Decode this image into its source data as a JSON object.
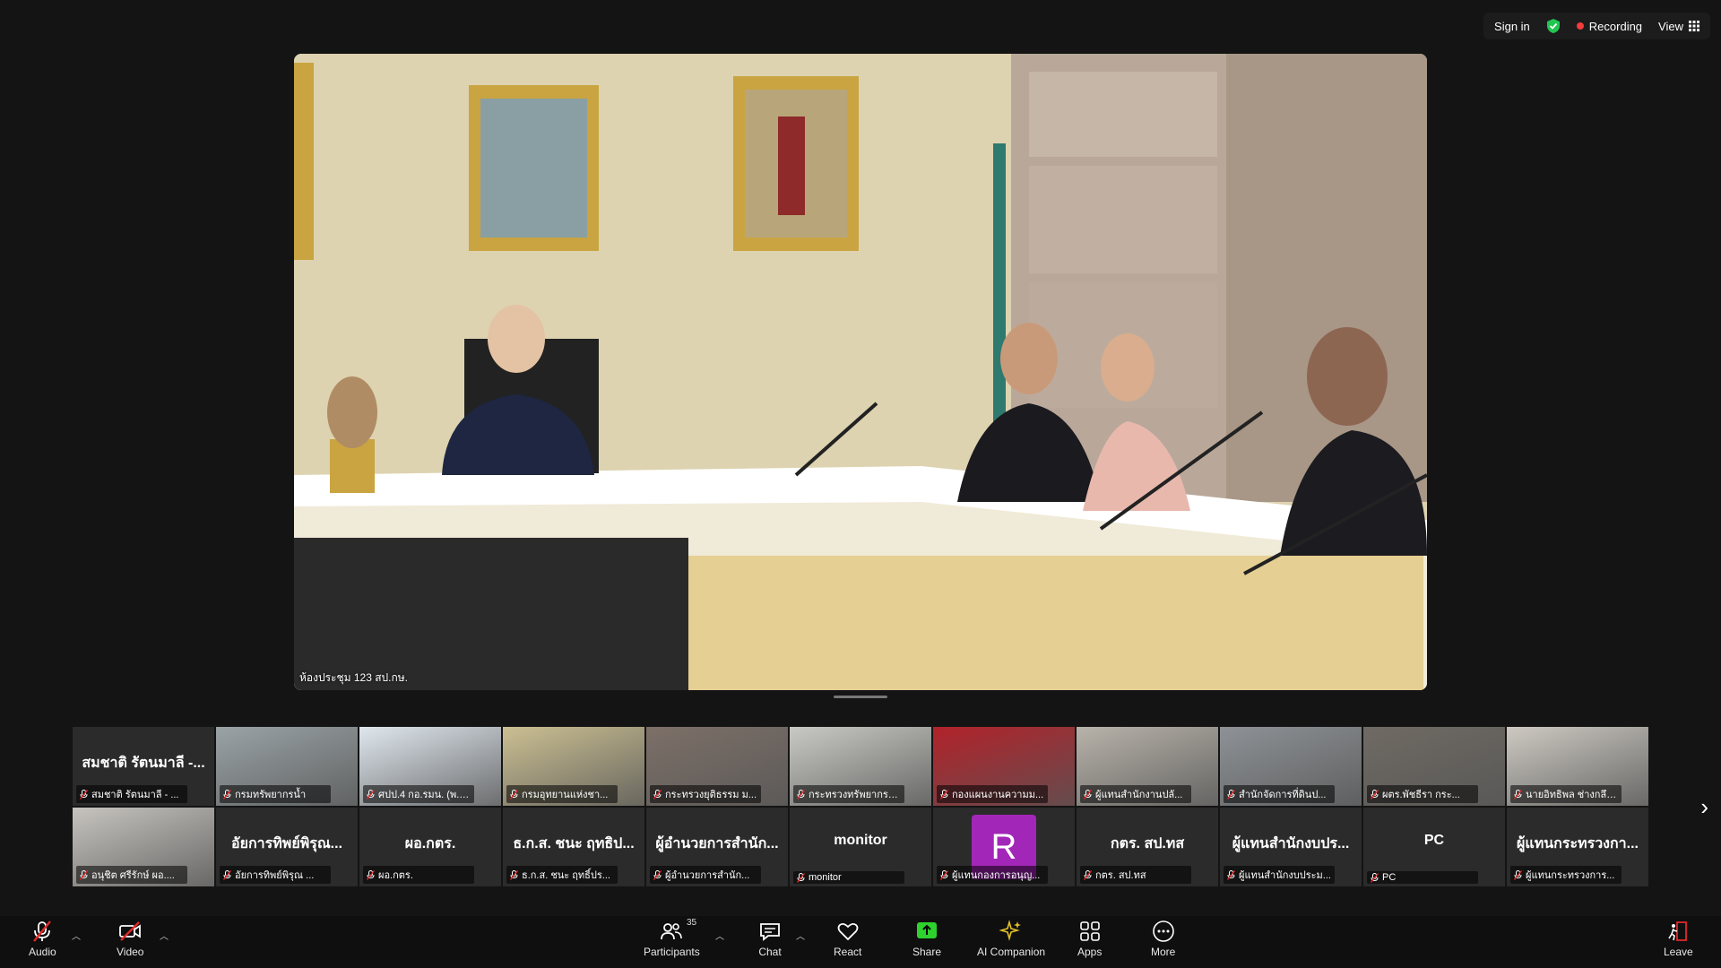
{
  "topbar": {
    "sign_in": "Sign in",
    "recording": "Recording",
    "view": "View"
  },
  "main_video": {
    "label": "ห้องประชุม 123 สป.กษ."
  },
  "gallery": {
    "row1": [
      {
        "big": "สมชาติ รัตนมาลี -...",
        "name": "สมชาติ รัตนมาลี - ...",
        "kind": "name"
      },
      {
        "name": "กรมทรัพยากรน้ำ",
        "kind": "video",
        "bg": "#9aa3a6"
      },
      {
        "name": "ศปป.4 กอ.รมน. (พ.อ.ไ...",
        "kind": "video",
        "bg": "#dfe7ee"
      },
      {
        "name": "กรมอุทยานแห่งชา...",
        "kind": "video",
        "bg": "#cbbf92"
      },
      {
        "name": "กระทรวงยุติธรรม ม...",
        "kind": "video",
        "bg": "#7d7068"
      },
      {
        "name": "กระทรวงทรัพยากรธรร...",
        "kind": "video",
        "bg": "#c9c9c4"
      },
      {
        "name": "กองแผนงานความม...",
        "kind": "video",
        "bg": "#b2222a"
      },
      {
        "name": "ผู้แทนสำนักงานปลั...",
        "kind": "video",
        "bg": "#b8b3aa"
      },
      {
        "name": "สำนักจัดการที่ดินป...",
        "kind": "video",
        "bg": "#8e9296"
      },
      {
        "name": "ผตร.พัชธีรา กระ...",
        "kind": "video",
        "bg": "#6f6a63"
      },
      {
        "name": "นายอิทธิพล ช่างกลึงด...",
        "kind": "video",
        "bg": "#cdc9c2"
      }
    ],
    "row2": [
      {
        "name": "อนุชิต ศรีรักษ์ ผอ....",
        "kind": "video",
        "bg": "#c7c4bf"
      },
      {
        "big": "อัยการทิพย์พิรุณ...",
        "name": "อัยการทิพย์พิรุณ ...",
        "kind": "name"
      },
      {
        "big": "ผอ.กตร.",
        "name": "ผอ.กตร.",
        "kind": "name"
      },
      {
        "big": "ธ.ก.ส. ชนะ ฤทธิป...",
        "name": "ธ.ก.ส. ชนะ ฤทธิ์ปร...",
        "kind": "name"
      },
      {
        "big": "ผู้อำนวยการสำนัก...",
        "name": "ผู้อำนวยการสำนัก...",
        "kind": "name"
      },
      {
        "big": "monitor",
        "name": "monitor",
        "kind": "name"
      },
      {
        "avatar": "R",
        "name": "ผู้แทนกองการอนุญ...",
        "kind": "avatar"
      },
      {
        "big": "กตร. สป.ทส",
        "name": "กตร. สป.ทส",
        "kind": "name"
      },
      {
        "big": "ผู้แทนสำนักงบปร...",
        "name": "ผู้แทนสำนักงบประม...",
        "kind": "name"
      },
      {
        "big": "PC",
        "name": "PC",
        "kind": "name"
      },
      {
        "big": "ผู้แทนกระทรวงกา...",
        "name": "ผู้แทนกระทรวงการ...",
        "kind": "name"
      }
    ]
  },
  "toolbar": {
    "audio": "Audio",
    "video": "Video",
    "participants": "Participants",
    "participant_count": "35",
    "chat": "Chat",
    "react": "React",
    "share": "Share",
    "ai_companion": "AI Companion",
    "apps": "Apps",
    "more": "More",
    "leave": "Leave"
  },
  "colors": {
    "share_green": "#2ed12e",
    "recording_red": "#f23d3d",
    "leave_red": "#e02828",
    "avatar_purple": "#a226b8"
  }
}
